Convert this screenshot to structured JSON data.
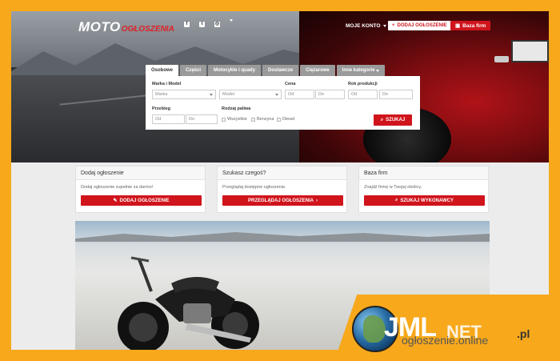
{
  "brand": {
    "logo_main": "MOTO",
    "logo_sub": "OGŁOSZENIA"
  },
  "nav": {
    "social_icons": [
      "facebook-icon",
      "twitter-icon",
      "instagram-icon"
    ],
    "language_flag": "pl-flag",
    "account_label": "MOJE KONTO",
    "add_listing_label": "DODAJ OGŁOSZENIE",
    "companies_label": "Baza firm"
  },
  "search": {
    "tabs": [
      {
        "label": "Osobowe",
        "active": true
      },
      {
        "label": "Części",
        "active": false
      },
      {
        "label": "Motocykle i quady",
        "active": false
      },
      {
        "label": "Dostawcze",
        "active": false
      },
      {
        "label": "Ciężarowe",
        "active": false
      },
      {
        "label": "Inne kategorie",
        "active": false,
        "dropdown": true
      }
    ],
    "brand_model_label": "Marka i Model",
    "brand_placeholder": "Marka",
    "model_placeholder": "Model",
    "price_label": "Cena",
    "price_from": "Od",
    "price_to": "Do",
    "year_label": "Rok produkcji",
    "year_from": "Od",
    "year_to": "Do",
    "mileage_label": "Przebieg",
    "mileage_from": "Od",
    "mileage_to": "Do",
    "fuel_label": "Rodzaj paliwa",
    "fuel_options": [
      "Wszystkie",
      "Benzyna",
      "Diesel"
    ],
    "search_button": "SZUKAJ"
  },
  "cards": [
    {
      "title": "Dodaj ogłoszenie",
      "text": "Dodaj ogłoszenie zupełnie za darmo!",
      "button": "DODAJ OGŁOSZENIE",
      "icon": "edit-icon"
    },
    {
      "title": "Szukasz czegoś?",
      "text": "Przeglądaj dostępne ogłoszenia",
      "button": "PRZEGLĄDAJ OGŁOSZENIA",
      "icon": "chevron-right-icon"
    },
    {
      "title": "Baza firm",
      "text": "Znajdź firmę w Twojej okolicy.",
      "button": "SZUKAJ WYKONAWCY",
      "icon": "search-icon"
    }
  ],
  "watermark": {
    "big": "JML",
    "mid": "NET",
    "tld": ".pl",
    "sub": "ogłoszenie",
    "sub2": ".online"
  },
  "colors": {
    "accent": "#d0141c",
    "frame": "#f7a81b"
  }
}
